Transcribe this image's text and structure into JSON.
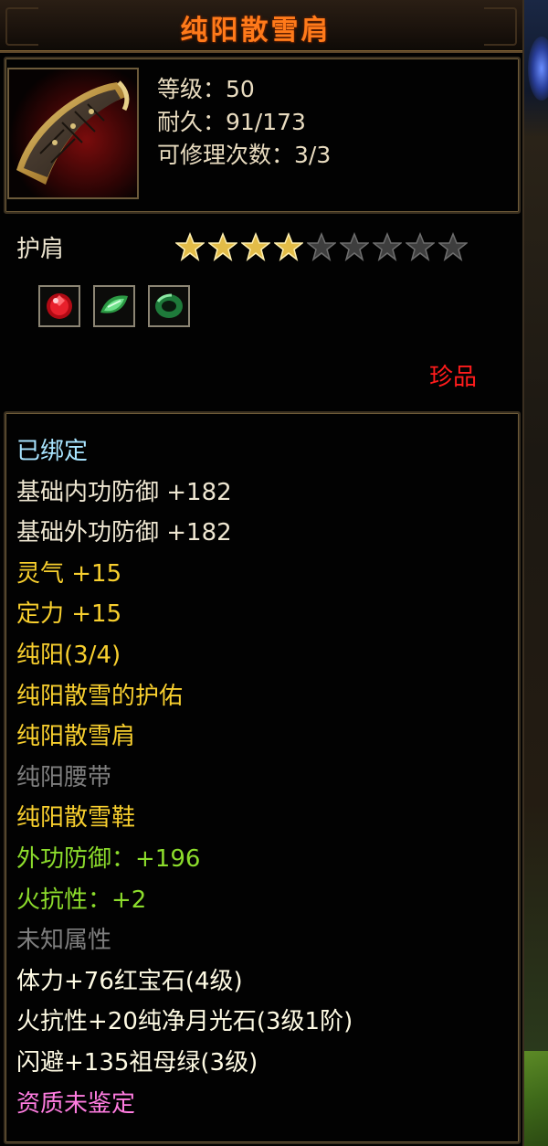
{
  "title": "纯阳散雪肩",
  "stats": {
    "level": "等级：50",
    "durability": "耐久：91/173",
    "repairs": "可修理次数：3/3"
  },
  "item_type": "护肩",
  "stars": {
    "filled": 4,
    "total": 9
  },
  "gem_slots": [
    "ruby-gem-icon",
    "green-crystal-gem-icon",
    "jade-ring-gem-icon"
  ],
  "rarity": "珍品",
  "lines": [
    {
      "text": "已绑定",
      "color": "cyan"
    },
    {
      "text": "基础内功防御  +182",
      "color": "white"
    },
    {
      "text": "基础外功防御  +182",
      "color": "white"
    },
    {
      "text": "灵气  +15",
      "color": "yellow"
    },
    {
      "text": "定力  +15",
      "color": "yellow"
    },
    {
      "text": "纯阳(3/4)",
      "color": "yellow"
    },
    {
      "text": "纯阳散雪的护佑",
      "color": "yellow"
    },
    {
      "text": "纯阳散雪肩",
      "color": "yellow"
    },
    {
      "text": "纯阳腰带",
      "color": "gray"
    },
    {
      "text": "纯阳散雪鞋",
      "color": "yellow"
    },
    {
      "text": "外功防御：+196",
      "color": "green"
    },
    {
      "text": "火抗性：+2",
      "color": "green"
    },
    {
      "text": "未知属性",
      "color": "gray"
    },
    {
      "text": "体力+76红宝石(4级)",
      "color": "bright"
    },
    {
      "text": "火抗性+20纯净月光石(3级1阶)",
      "color": "bright"
    },
    {
      "text": "闪避+135祖母绿(3级)",
      "color": "bright"
    },
    {
      "text": "资质未鉴定",
      "color": "pink"
    }
  ]
}
